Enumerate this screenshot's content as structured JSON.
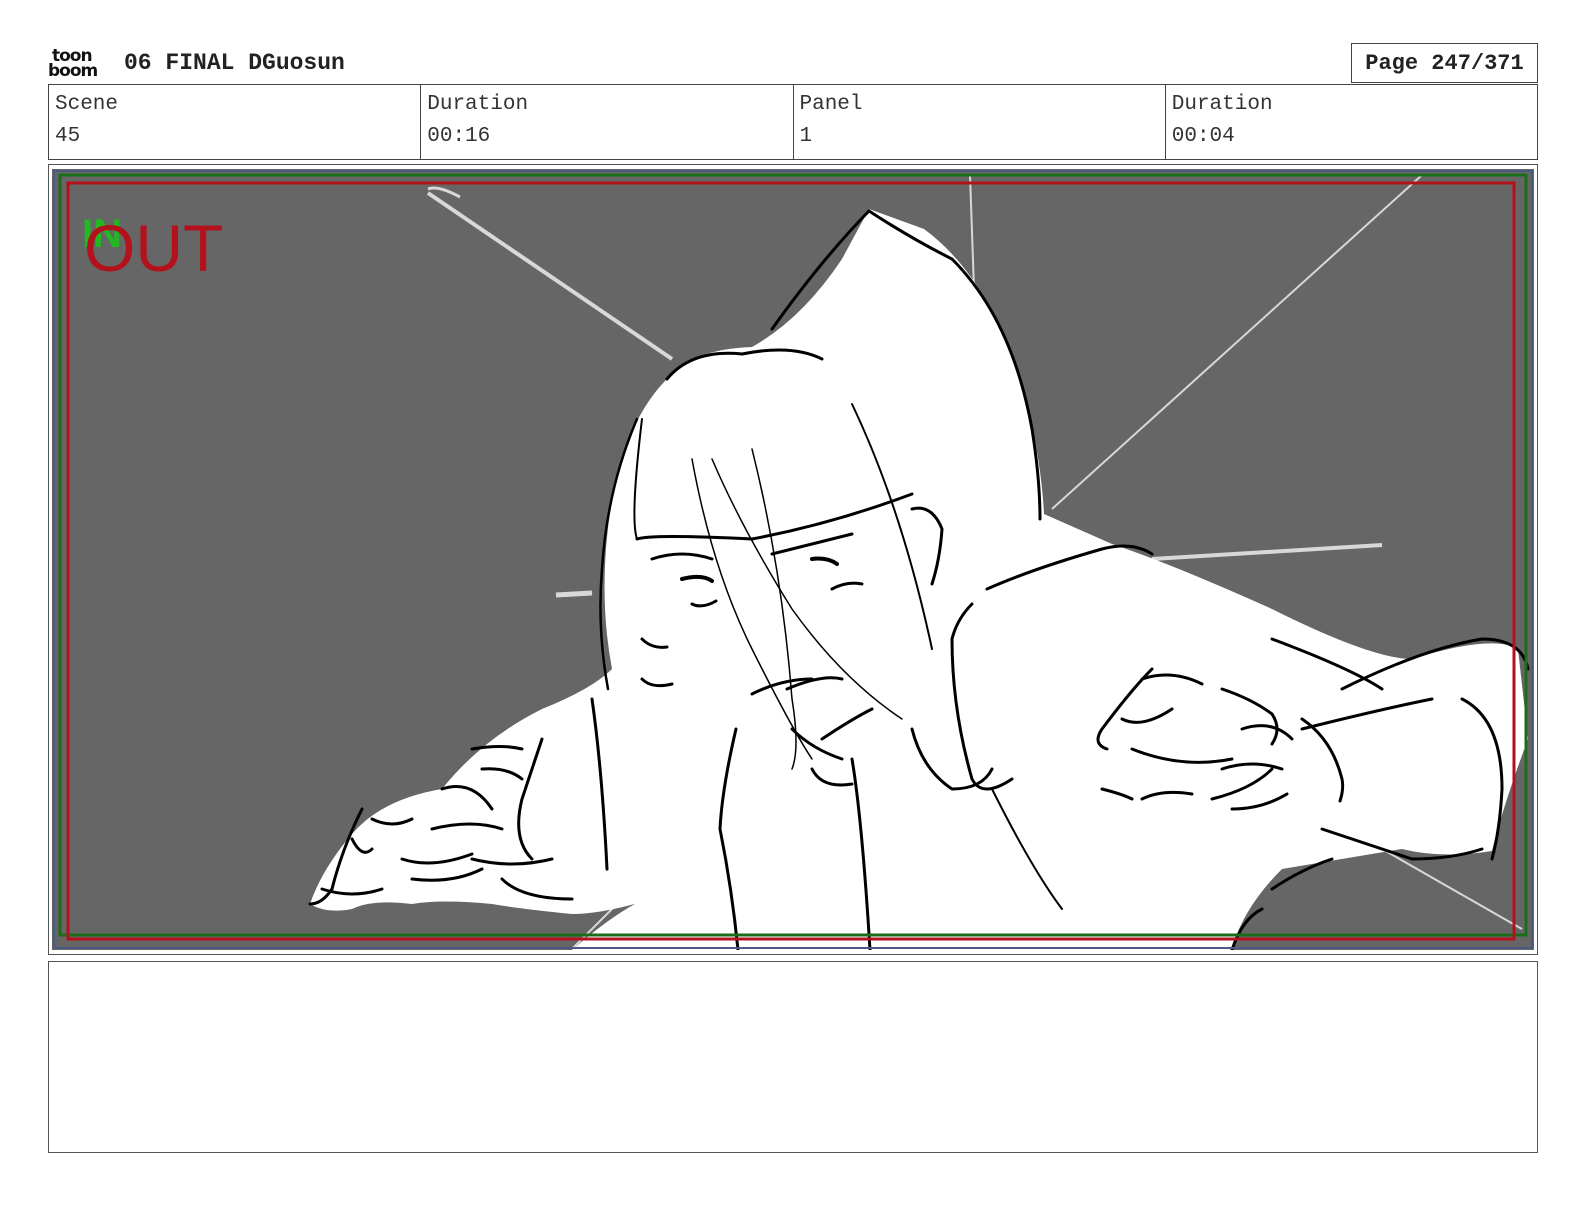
{
  "header": {
    "logo_top": "toon",
    "logo_bottom": "boom",
    "title": "06 FINAL DGuosun",
    "page": "Page 247/371"
  },
  "info": [
    {
      "label": "Scene",
      "value": "45"
    },
    {
      "label": "Duration",
      "value": "00:16"
    },
    {
      "label": "Panel",
      "value": "1"
    },
    {
      "label": "Duration",
      "value": "00:04"
    }
  ],
  "panel": {
    "overlay_text": "OUT",
    "colors": {
      "background": "#666666",
      "figure": "#ffffff",
      "ink": "#000000",
      "safe_frame_green": "#1a6e1a",
      "action_frame_red": "#b3121c",
      "overlay_red": "#b3121c",
      "overlay_green": "#22b822"
    }
  },
  "notes": {
    "text": ""
  }
}
